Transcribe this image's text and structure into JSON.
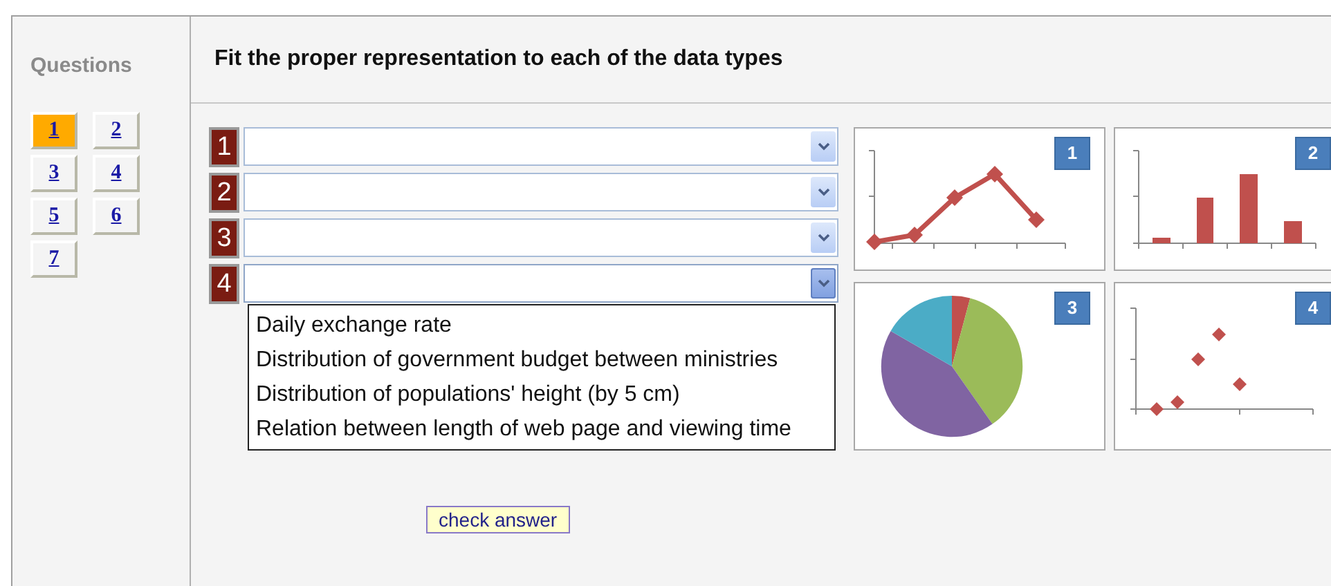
{
  "sidebar": {
    "title": "Questions",
    "questions": [
      {
        "label": "1",
        "selected": true
      },
      {
        "label": "2",
        "selected": false
      },
      {
        "label": "3",
        "selected": false
      },
      {
        "label": "4",
        "selected": false
      },
      {
        "label": "5",
        "selected": false
      },
      {
        "label": "6",
        "selected": false
      },
      {
        "label": "7",
        "selected": false
      }
    ]
  },
  "main": {
    "heading": "Fit the proper representation to each of the data types",
    "answers": [
      {
        "number": "1",
        "open": false
      },
      {
        "number": "2",
        "open": false
      },
      {
        "number": "3",
        "open": false
      },
      {
        "number": "4",
        "open": true
      }
    ],
    "dropdown_options": [
      "Daily exchange rate",
      "Distribution of government budget between ministries",
      "Distribution of populations' height (by 5 cm)",
      "Relation between length of web page and viewing time"
    ],
    "charts": [
      {
        "badge": "1",
        "kind": "line"
      },
      {
        "badge": "2",
        "kind": "bar"
      },
      {
        "badge": "3",
        "kind": "pie"
      },
      {
        "badge": "4",
        "kind": "scatter"
      }
    ],
    "check_button": "check answer"
  }
}
